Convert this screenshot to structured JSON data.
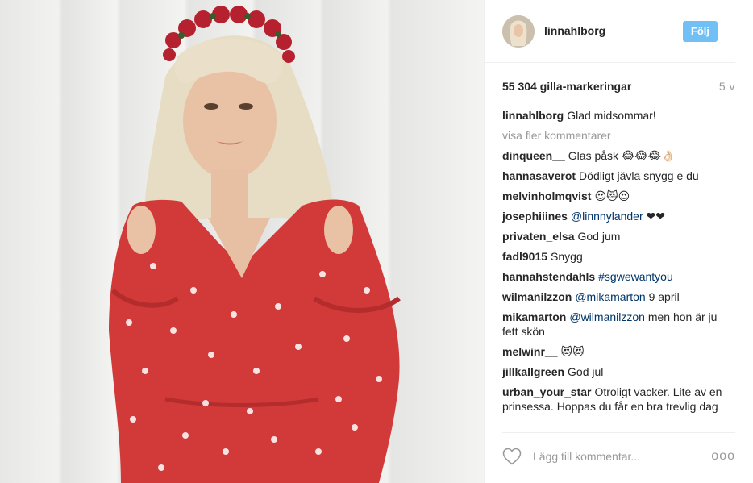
{
  "post": {
    "username": "linnahlborg",
    "follow_label": "Följ",
    "likes": "55 304 gilla-markeringar",
    "age": "5 v",
    "caption": {
      "user": "linnahlborg",
      "text": "Glad midsommar!"
    },
    "more_comments": "visa fler kommentarer",
    "comments": [
      {
        "user": "dinqueen__",
        "text": "Glas påsk 😂😂😂👌🏻"
      },
      {
        "user": "hannasaverot",
        "text": "Dödligt jävla snygg e du"
      },
      {
        "user": "melvinholmqvist",
        "text": "😍😻😍"
      },
      {
        "user": "josephiiines",
        "mention": "@linnnylander",
        "text": "❤❤"
      },
      {
        "user": "privaten_elsa",
        "text": "God jum"
      },
      {
        "user": "fadl9015",
        "text": "Snygg"
      },
      {
        "user": "hannahstendahls",
        "mention": "#sgwewantyou",
        "text": ""
      },
      {
        "user": "wilmanilzzon",
        "mention": "@mikamarton",
        "text": "9 april"
      },
      {
        "user": "mikamarton",
        "mention": "@wilmanilzzon",
        "text": "men hon är ju fett skön"
      },
      {
        "user": "melwinr__",
        "text": "😻😻"
      },
      {
        "user": "jillkallgreen",
        "text": "God jul"
      },
      {
        "user": "urban_your_star",
        "text": "Otroligt vacker. Lite av en prinsessa. Hoppas du får en bra trevlig dag"
      }
    ],
    "add_comment_placeholder": "Lägg till kommentar...",
    "more_options": "ooo"
  },
  "colors": {
    "follow_bg": "#70c0f6",
    "mention": "#003569",
    "muted": "#999999",
    "dress_red": "#d23a3a"
  },
  "icons": {
    "like": "heart-outline-icon",
    "options": "more-options-icon"
  }
}
